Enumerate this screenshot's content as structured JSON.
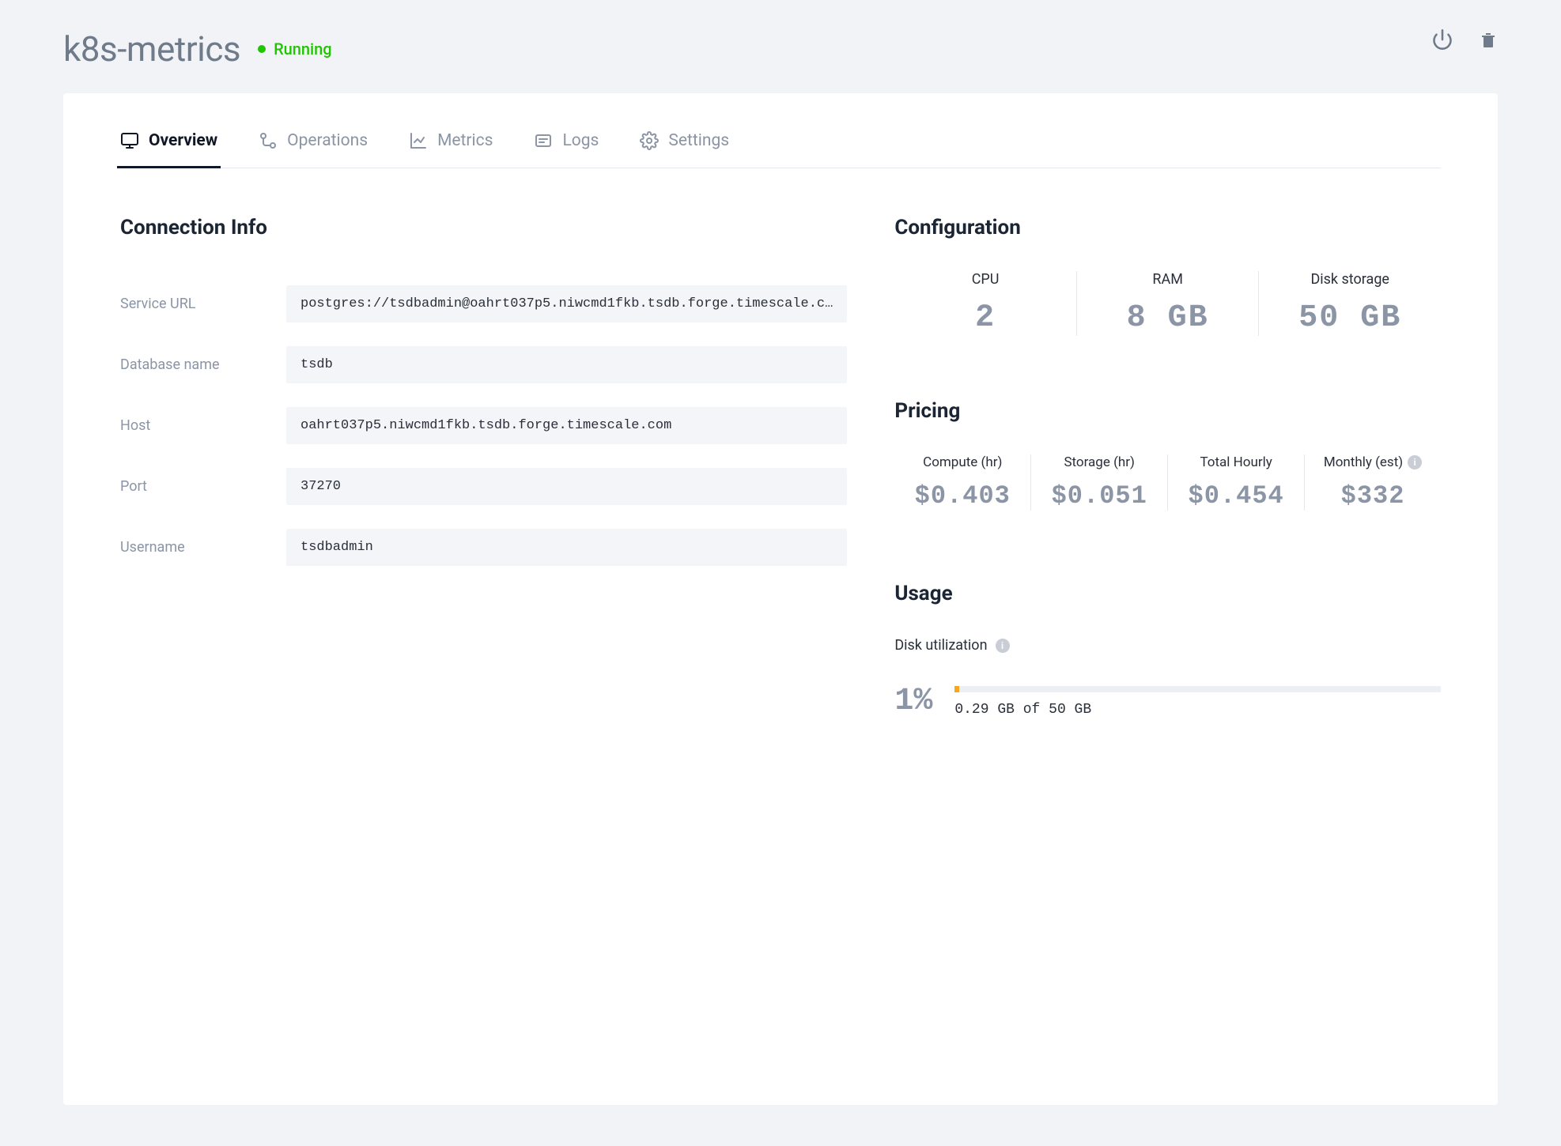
{
  "header": {
    "title": "k8s-metrics",
    "status_label": "Running"
  },
  "tabs": [
    {
      "label": "Overview",
      "icon": "monitor-icon",
      "active": true
    },
    {
      "label": "Operations",
      "icon": "workflow-icon",
      "active": false
    },
    {
      "label": "Metrics",
      "icon": "chart-icon",
      "active": false
    },
    {
      "label": "Logs",
      "icon": "log-icon",
      "active": false
    },
    {
      "label": "Settings",
      "icon": "gear-icon",
      "active": false
    }
  ],
  "connection": {
    "heading": "Connection Info",
    "fields": {
      "service_url": {
        "label": "Service URL",
        "value": "postgres://tsdbadmin@oahrt037p5.niwcmd1fkb.tsdb.forge.timescale.c…"
      },
      "db_name": {
        "label": "Database name",
        "value": "tsdb"
      },
      "host": {
        "label": "Host",
        "value": "oahrt037p5.niwcmd1fkb.tsdb.forge.timescale.com"
      },
      "port": {
        "label": "Port",
        "value": "37270"
      },
      "username": {
        "label": "Username",
        "value": "tsdbadmin"
      }
    }
  },
  "configuration": {
    "heading": "Configuration",
    "cpu": {
      "label": "CPU",
      "value": "2"
    },
    "ram": {
      "label": "RAM",
      "value": "8 GB"
    },
    "disk": {
      "label": "Disk storage",
      "value": "50 GB"
    }
  },
  "pricing": {
    "heading": "Pricing",
    "compute": {
      "label": "Compute (hr)",
      "value": "$0.403"
    },
    "storage": {
      "label": "Storage (hr)",
      "value": "$0.051"
    },
    "total": {
      "label": "Total Hourly",
      "value": "$0.454"
    },
    "monthly": {
      "label": "Monthly (est)",
      "value": "$332"
    }
  },
  "usage": {
    "heading": "Usage",
    "label": "Disk utilization",
    "percent_text": "1%",
    "percent_numeric": 1,
    "detail": "0.29 GB of 50 GB"
  }
}
